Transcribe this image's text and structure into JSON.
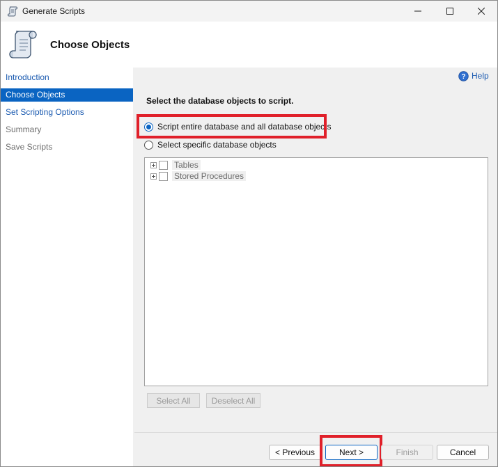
{
  "window": {
    "title": "Generate Scripts",
    "icon": "scroll-icon"
  },
  "header": {
    "title": "Choose Objects",
    "icon": "scroll-icon"
  },
  "sidebar": {
    "items": [
      {
        "label": "Introduction",
        "state": "link"
      },
      {
        "label": "Choose Objects",
        "state": "selected"
      },
      {
        "label": "Set Scripting Options",
        "state": "link"
      },
      {
        "label": "Summary",
        "state": "disabled"
      },
      {
        "label": "Save Scripts",
        "state": "disabled"
      }
    ]
  },
  "main": {
    "help_label": "Help",
    "instruction": "Select the database objects to script.",
    "options": [
      {
        "label": "Script entire database and all database objects",
        "checked": true
      },
      {
        "label": "Select specific database objects",
        "checked": false
      }
    ],
    "tree": [
      {
        "label": "Tables"
      },
      {
        "label": "Stored Procedures"
      }
    ],
    "select_all_label": "Select All",
    "deselect_all_label": "Deselect All"
  },
  "footer": {
    "previous_label": "< Previous",
    "next_label": "Next >",
    "finish_label": "Finish",
    "cancel_label": "Cancel"
  },
  "colors": {
    "accent": "#0a64c2",
    "highlight": "#e0202a",
    "link": "#1a5ab0"
  }
}
